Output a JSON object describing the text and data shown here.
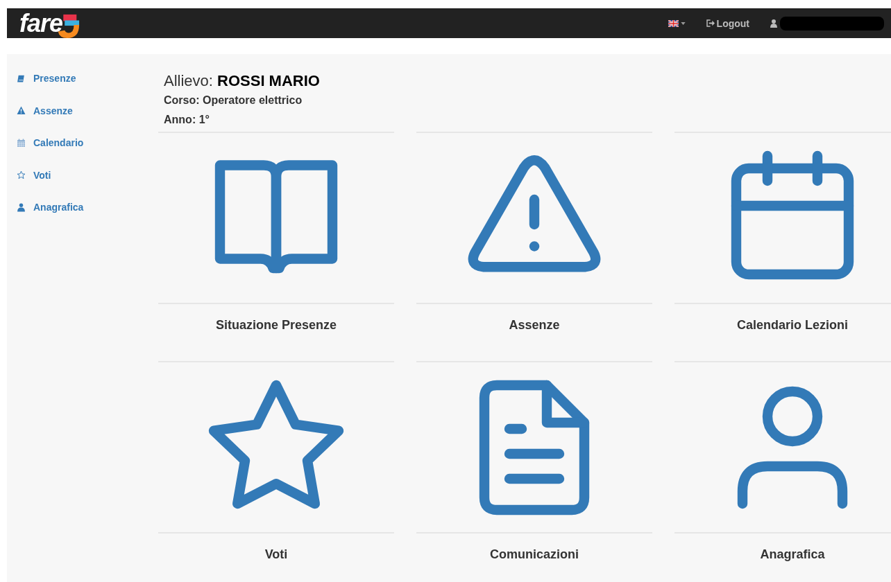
{
  "navbar": {
    "logo": "fare",
    "logout": "Logout"
  },
  "sidebar": {
    "items": [
      {
        "label": "Presenze",
        "kind": "book"
      },
      {
        "label": "Assenze",
        "kind": "warning"
      },
      {
        "label": "Calendario",
        "kind": "calendar"
      },
      {
        "label": "Voti",
        "kind": "star"
      },
      {
        "label": "Anagrafica",
        "kind": "user"
      }
    ]
  },
  "student": {
    "label": "Allievo:",
    "name": "ROSSI MARIO",
    "course": "Corso: Operatore elettrico",
    "year": "Anno: 1°"
  },
  "tiles": [
    {
      "label": "Situazione Presenze",
      "kind": "book"
    },
    {
      "label": "Assenze",
      "kind": "warning"
    },
    {
      "label": "Calendario Lezioni",
      "kind": "calendar"
    },
    {
      "label": "Voti",
      "kind": "star"
    },
    {
      "label": "Comunicazioni",
      "kind": "document"
    },
    {
      "label": "Anagrafica",
      "kind": "user"
    }
  ]
}
